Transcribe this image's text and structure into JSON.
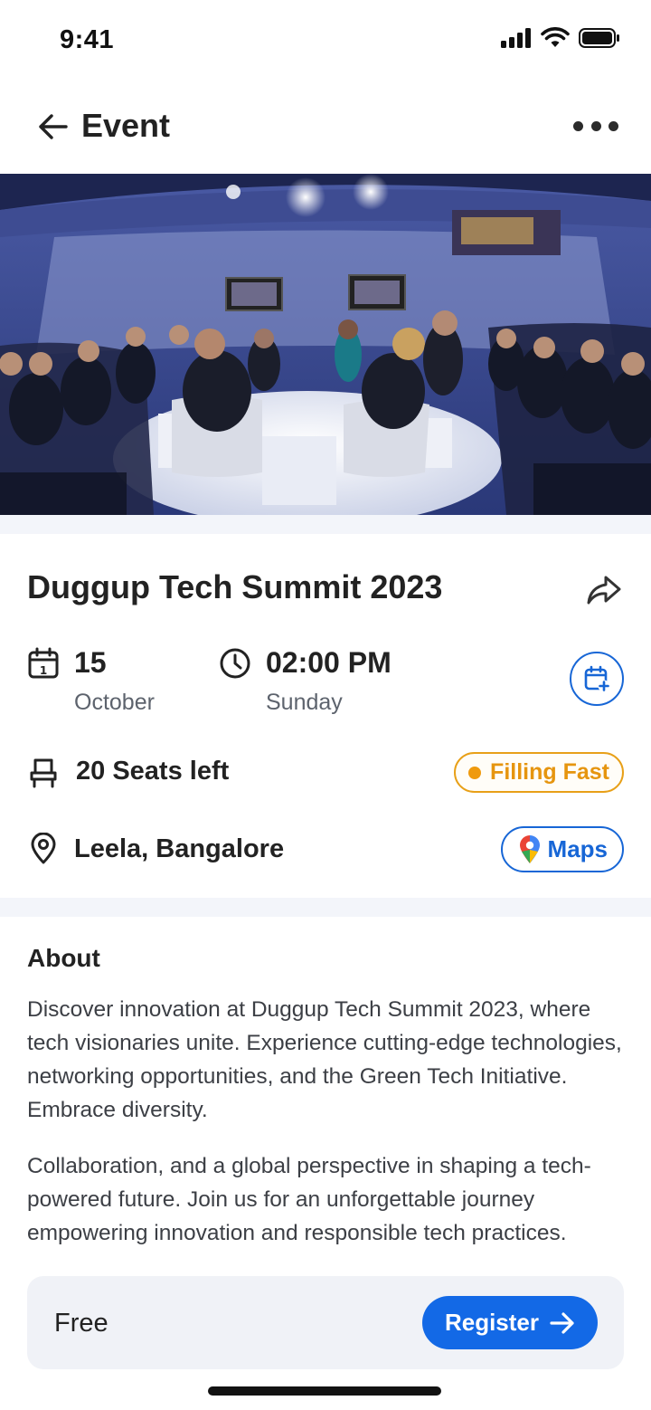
{
  "status_bar": {
    "time": "9:41"
  },
  "header": {
    "title": "Event"
  },
  "event": {
    "title": "Duggup Tech Summit 2023",
    "date_day": "15",
    "date_month": "October",
    "time": "02:00 PM",
    "weekday": "Sunday",
    "seats": "20 Seats left",
    "badge": "Filling Fast",
    "location": "Leela, Bangalore",
    "maps_label": "Maps"
  },
  "about": {
    "title": "About",
    "paragraphs": [
      "Discover innovation at Duggup Tech Summit 2023, where tech visionaries unite. Experience cutting-edge technologies, networking opportunities, and the Green Tech Initiative. Embrace diversity.",
      "Collaboration, and a global perspective in shaping a tech-powered future. Join us for an unforgettable journey empowering innovation and responsible tech practices."
    ]
  },
  "footer": {
    "price": "Free",
    "register_label": "Register"
  },
  "colors": {
    "accent": "#1369e6",
    "warning": "#e8a018",
    "text": "#222222"
  },
  "icons": [
    "back-arrow-icon",
    "more-icon",
    "share-icon",
    "calendar-icon",
    "clock-icon",
    "calendar-add-icon",
    "seat-icon",
    "location-pin-icon",
    "google-maps-icon",
    "arrow-right-icon"
  ]
}
